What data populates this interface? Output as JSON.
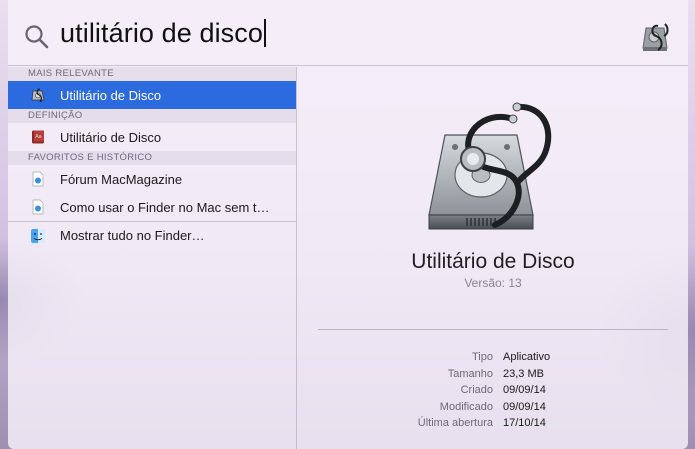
{
  "search": {
    "query": "utilitário de disco"
  },
  "results": {
    "sections": [
      {
        "header": "MAIS RELEVANTE",
        "items": [
          {
            "label": "Utilitário de Disco",
            "icon": "disk-utility-icon",
            "selected": true
          }
        ]
      },
      {
        "header": "DEFINIÇÃO",
        "items": [
          {
            "label": "Utilitário de Disco",
            "icon": "dictionary-icon",
            "selected": false
          }
        ]
      },
      {
        "header": "FAVORITOS E HISTÓRICO",
        "items": [
          {
            "label": "Fórum MacMagazine",
            "icon": "bookmark-icon",
            "selected": false
          },
          {
            "label": "Como usar o Finder no Mac sem t…",
            "icon": "bookmark-icon",
            "selected": false
          }
        ]
      }
    ],
    "show_all": {
      "label": "Mostrar tudo no Finder…",
      "icon": "finder-icon"
    }
  },
  "preview": {
    "title": "Utilitário de Disco",
    "version": "Versão: 13",
    "meta": [
      {
        "key": "Tipo",
        "value": "Aplicativo"
      },
      {
        "key": "Tamanho",
        "value": "23,3 MB"
      },
      {
        "key": "Criado",
        "value": "09/09/14"
      },
      {
        "key": "Modificado",
        "value": "09/09/14"
      },
      {
        "key": "Última abertura",
        "value": "17/10/14"
      }
    ]
  },
  "colors": {
    "selection": "#2c6ae0",
    "panel": "#f8f2fa"
  }
}
